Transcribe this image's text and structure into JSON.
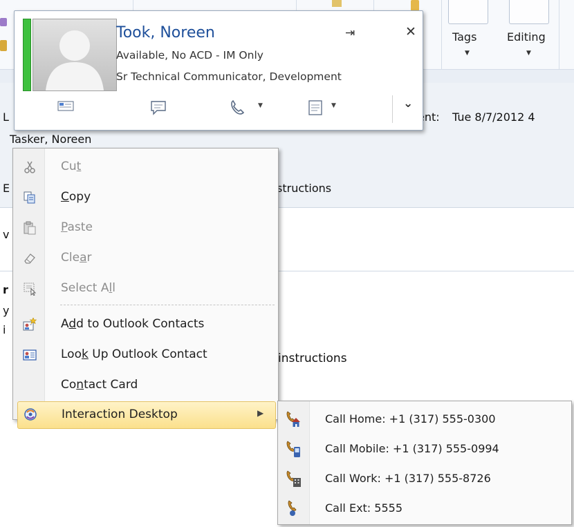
{
  "ribbon": {
    "tags_label": "Tags",
    "editing_label": "Editing"
  },
  "message": {
    "sent_label": "ent:",
    "sent_value": "Tue 8/7/2012 4",
    "to_value": "Tasker, Noreen",
    "fragment_1": "structions",
    "fragment_2": "instructions",
    "left_chars": [
      "L",
      "E",
      "v",
      "r",
      "y",
      "i"
    ]
  },
  "contact_card": {
    "name": "Took, Noreen",
    "status": "Available, No ACD - IM Only",
    "title": "Sr Technical Communicator, Development",
    "presence_color": "#3ec13e",
    "actions": [
      "email-icon",
      "im-icon",
      "phone-icon",
      "schedule-icon",
      "expand-chevron-icon"
    ]
  },
  "context_menu": {
    "items": [
      {
        "label_pre": "Cu",
        "label_u": "t",
        "label_post": "",
        "icon": "scissors-icon",
        "enabled": false
      },
      {
        "label_pre": "",
        "label_u": "C",
        "label_post": "opy",
        "icon": "copy-icon",
        "enabled": true
      },
      {
        "label_pre": "",
        "label_u": "P",
        "label_post": "aste",
        "icon": "paste-icon",
        "enabled": false
      },
      {
        "label_pre": "Cle",
        "label_u": "a",
        "label_post": "r",
        "icon": "eraser-icon",
        "enabled": false
      },
      {
        "label_pre": "Select A",
        "label_u": "l",
        "label_post": "l",
        "icon": "select-all-icon",
        "enabled": false
      },
      {
        "label_pre": "A",
        "label_u": "d",
        "label_post": "d to Outlook Contacts",
        "icon": "add-contact-icon",
        "enabled": true
      },
      {
        "label_pre": "Loo",
        "label_u": "k",
        "label_post": " Up Outlook Contact",
        "icon": "contact-card-icon",
        "enabled": true
      },
      {
        "label_pre": "Co",
        "label_u": "n",
        "label_post": "tact Card",
        "icon": "",
        "enabled": true
      },
      {
        "label_pre": "Interaction Desktop",
        "label_u": "",
        "label_post": "",
        "icon": "interaction-desktop-icon",
        "enabled": true,
        "highlighted": true
      }
    ]
  },
  "submenu": {
    "items": [
      {
        "label": "Call Home: +1 (317) 555-0300",
        "icon": "call-home-icon"
      },
      {
        "label": "Call Mobile: +1 (317) 555-0994",
        "icon": "call-mobile-icon"
      },
      {
        "label": "Call Work: +1 (317) 555-8726",
        "icon": "call-work-icon"
      },
      {
        "label": "Call Ext: 5555",
        "icon": "call-ext-icon"
      }
    ]
  }
}
